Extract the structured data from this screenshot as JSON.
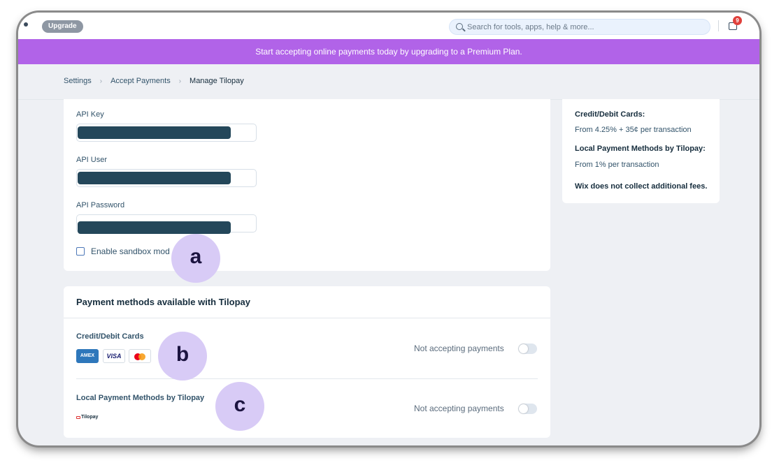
{
  "topbar": {
    "upgrade_label": "Upgrade",
    "search_placeholder": "Search for tools, apps, help & more...",
    "notification_count": "9"
  },
  "banner": {
    "text": "Start accepting online payments today by upgrading to a Premium Plan."
  },
  "breadcrumb": {
    "items": [
      "Settings",
      "Accept Payments",
      "Manage Tilopay"
    ]
  },
  "credentials": {
    "api_key_label": "API Key",
    "api_user_label": "API User",
    "api_password_label": "API Password",
    "sandbox_label": "Enable sandbox mod"
  },
  "payment_methods": {
    "title": "Payment methods available with Tilopay",
    "methods": [
      {
        "name": "Credit/Debit Cards",
        "status": "Not accepting payments",
        "logos": [
          "AMEX",
          "VISA",
          "mastercard"
        ]
      },
      {
        "name": "Local Payment Methods by Tilopay",
        "status": "Not accepting payments",
        "logo_text": "Tilopay"
      }
    ]
  },
  "fees": {
    "cards_heading": "Credit/Debit Cards:",
    "cards_fee": "From 4.25% + 35¢ per transaction",
    "local_heading": "Local Payment Methods by Tilopay:",
    "local_fee": "From 1% per transaction",
    "note": "Wix does not collect additional fees."
  },
  "annotations": [
    "a",
    "b",
    "c"
  ],
  "colors": {
    "banner": "#b163e8",
    "bubble": "#d8cbf6",
    "redaction": "#24475a",
    "badge": "#e0403b"
  }
}
